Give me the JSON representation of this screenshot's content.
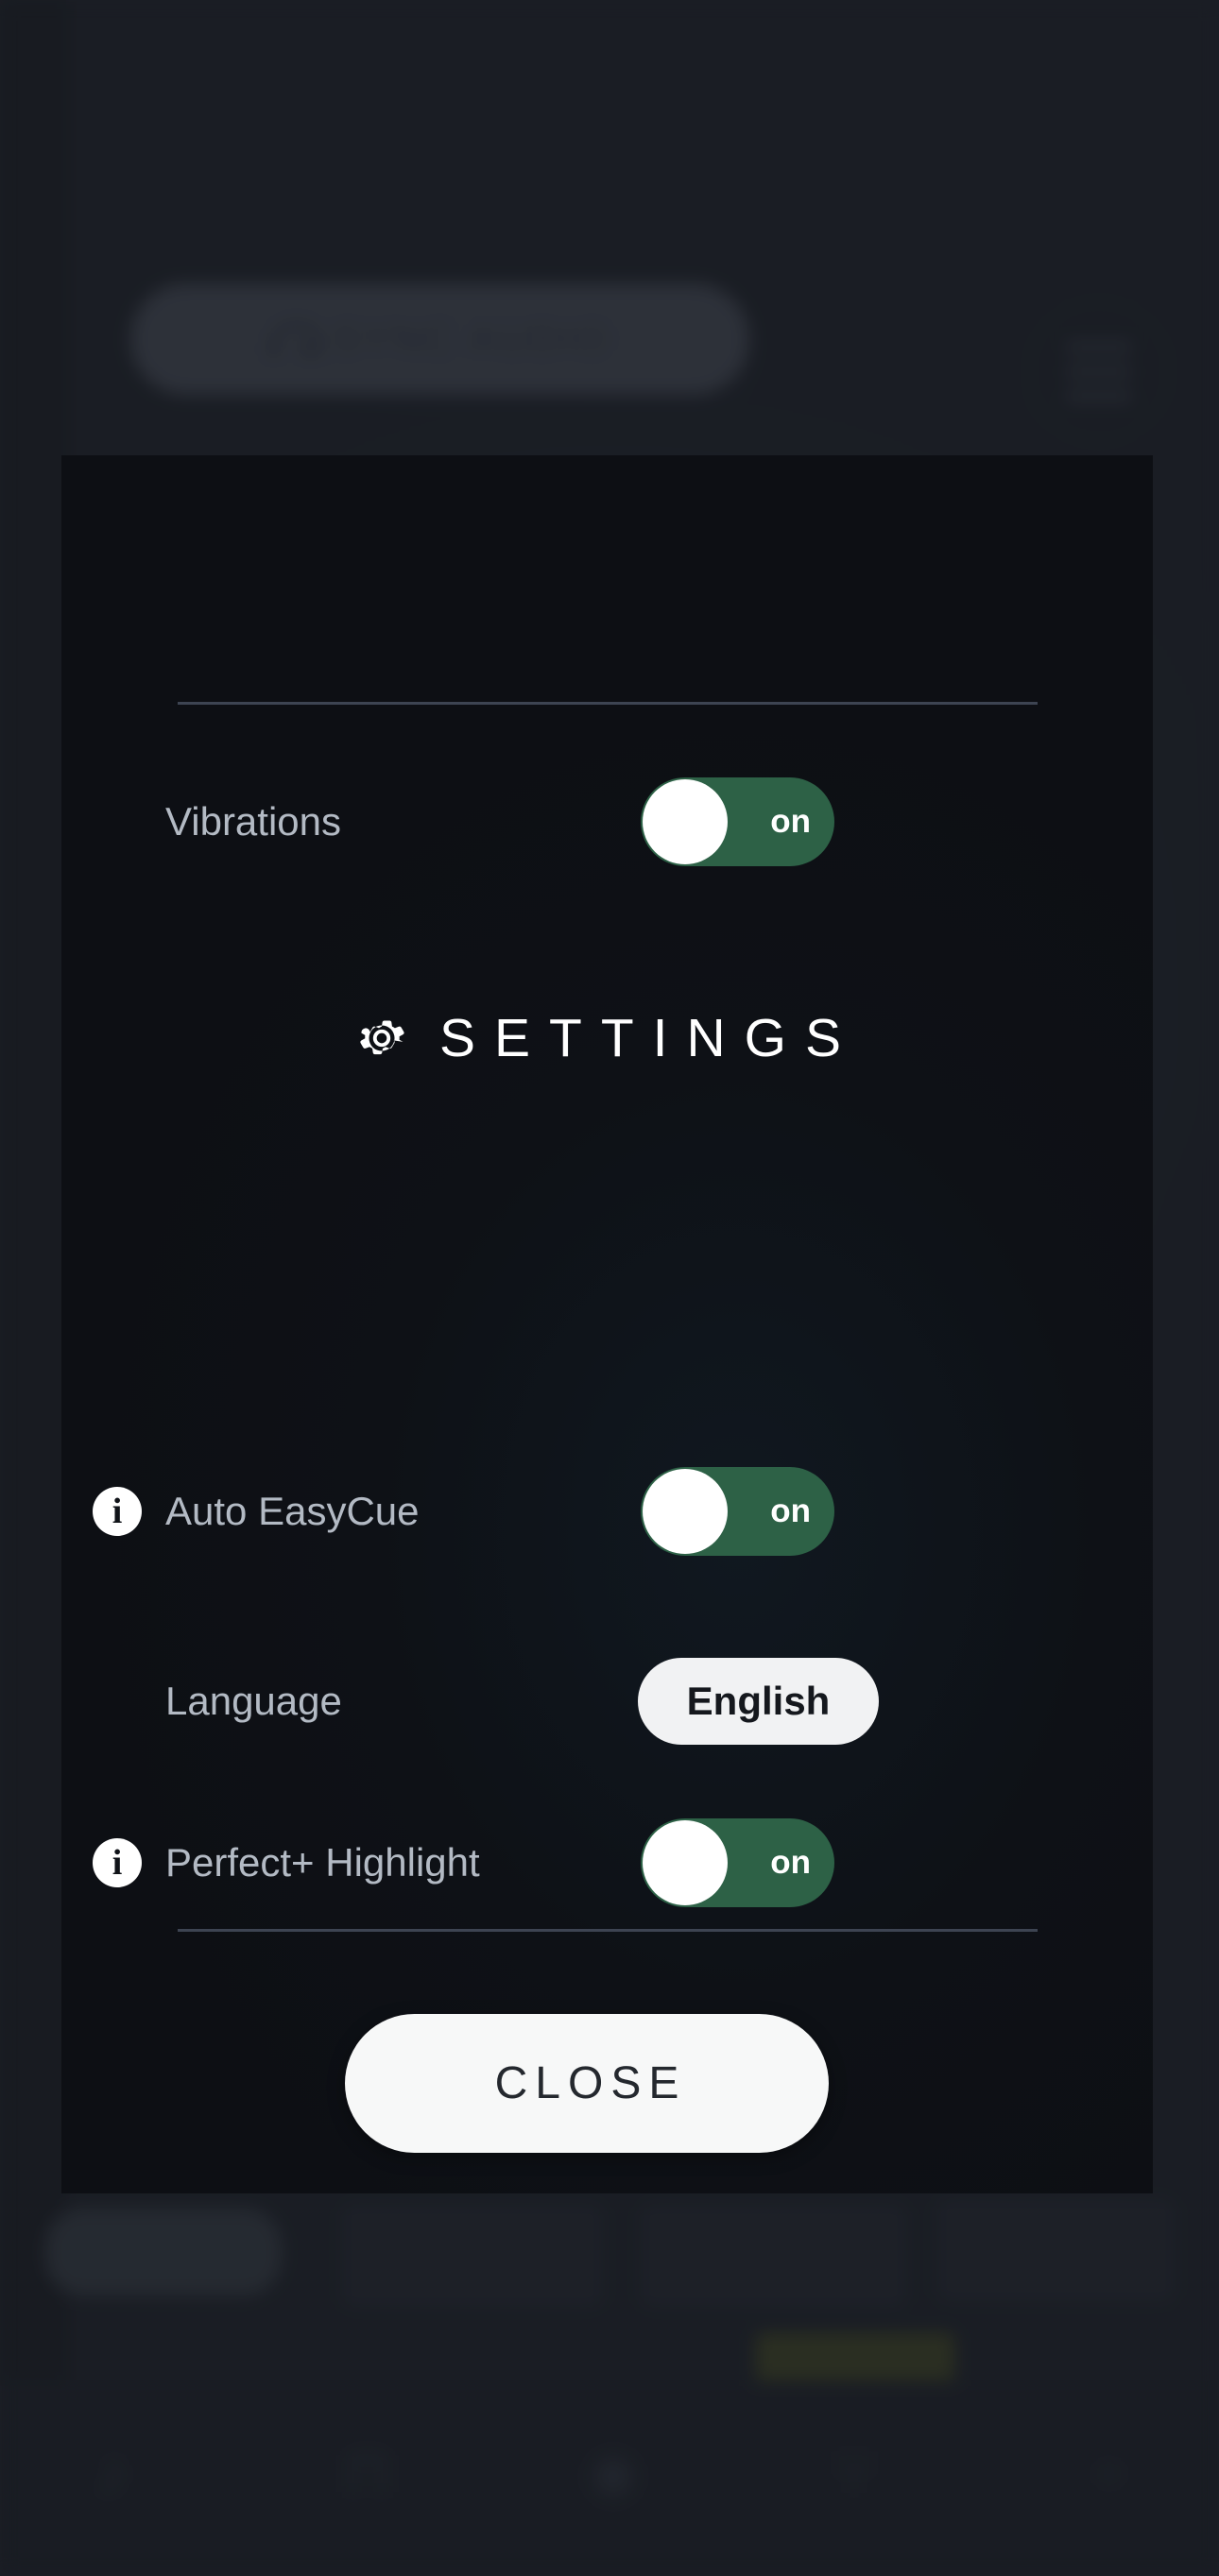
{
  "background": {
    "sync_audio_label": "SYNC AUDIO",
    "sync_audio_icon": "headphone-icon",
    "menu_icon": "hamburger-menu-icon",
    "nav_items": [
      {
        "icon": "note-icon",
        "glyph": "♪"
      },
      {
        "icon": "drum-icon",
        "glyph": "⊓"
      },
      {
        "icon": "record-icon",
        "glyph": "◉"
      },
      {
        "icon": "tuner-icon",
        "glyph": "⑂"
      },
      {
        "icon": "metronome-icon",
        "glyph": "▫"
      }
    ]
  },
  "modal": {
    "title": "SETTINGS",
    "title_icon": "gear-icon",
    "rows": [
      {
        "label": "Vibrations",
        "control": "toggle",
        "state": "on",
        "has_info": false,
        "info_icon": "",
        "name": "vibrations"
      },
      {
        "label": "Auto EasyCue",
        "control": "toggle",
        "state": "on",
        "has_info": true,
        "info_icon": "info-icon",
        "name": "auto-easycue"
      },
      {
        "label": "Language",
        "control": "value",
        "state": "English",
        "has_info": false,
        "info_icon": "",
        "name": "language"
      },
      {
        "label": "Perfect+ Highlight",
        "control": "toggle",
        "state": "on",
        "has_info": true,
        "info_icon": "info-icon",
        "name": "perfect-plus-highlight"
      }
    ],
    "close_label": "CLOSE"
  },
  "colors": {
    "toggle_on": "#2d6146",
    "modal_bg": "#0e1116",
    "backdrop": "#272b33",
    "label": "#b3bac4",
    "accent_white": "#ffffff"
  }
}
